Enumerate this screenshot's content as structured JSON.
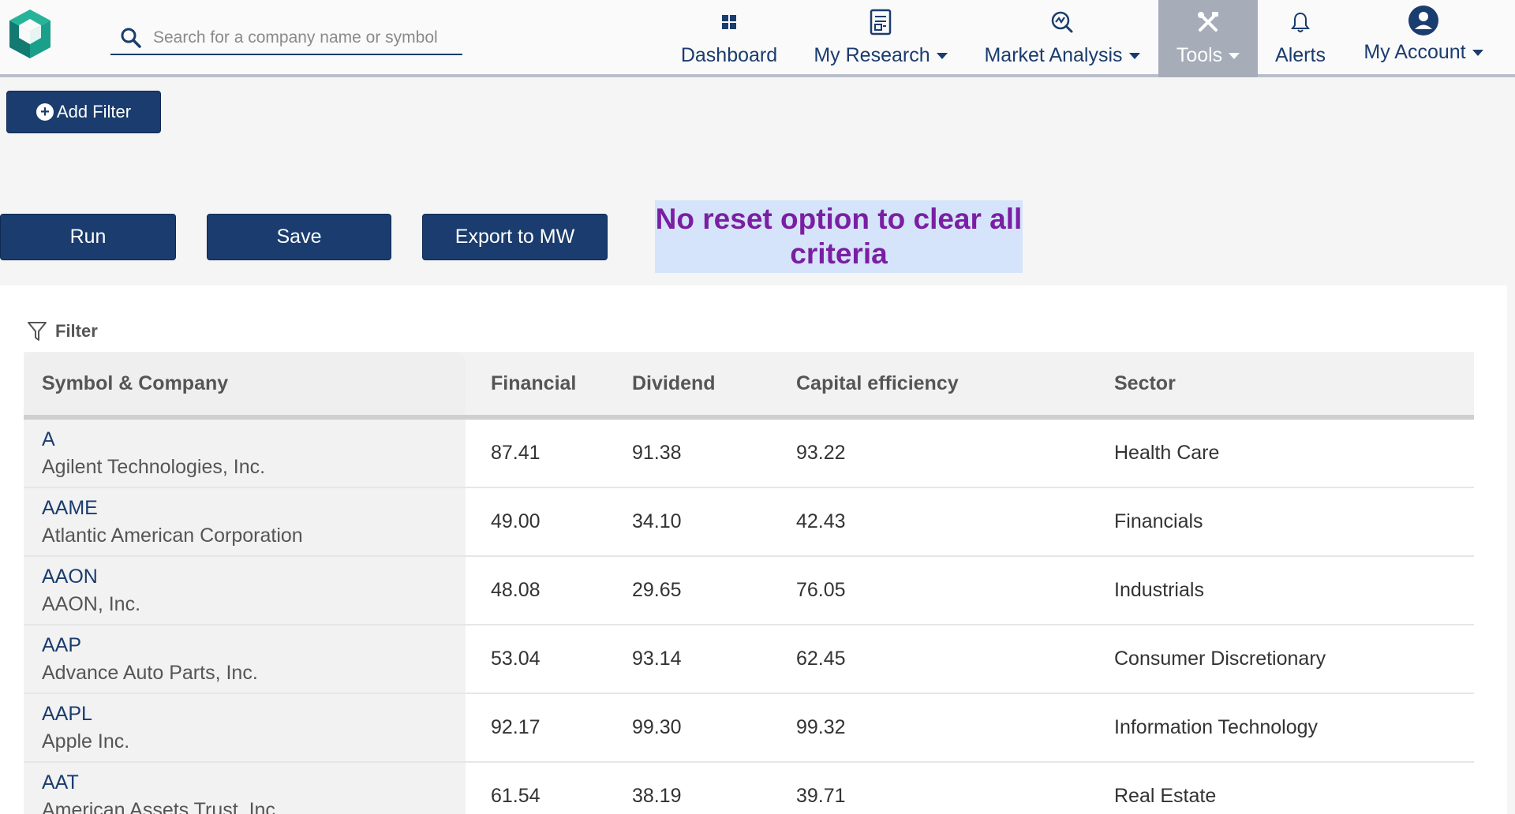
{
  "header": {
    "search_placeholder": "Search for a company name or symbol",
    "nav": [
      {
        "label": "Dashboard",
        "icon": "dashboard-icon",
        "dropdown": false
      },
      {
        "label": "My Research",
        "icon": "document-icon",
        "dropdown": true
      },
      {
        "label": "Market Analysis",
        "icon": "analysis-icon",
        "dropdown": true
      },
      {
        "label": "Tools",
        "icon": "tools-icon",
        "dropdown": true,
        "active": true
      },
      {
        "label": "Alerts",
        "icon": "bell-icon",
        "dropdown": false
      },
      {
        "label": "My Account",
        "icon": "user-icon",
        "dropdown": true
      }
    ]
  },
  "controls": {
    "add_filter": "Add Filter",
    "run": "Run",
    "save": "Save",
    "export": "Export to MW"
  },
  "annotation": {
    "line1": "No reset option to clear all",
    "line2": "criteria"
  },
  "table": {
    "filter_label": "Filter",
    "headers": [
      "Symbol & Company",
      "Financial",
      "Dividend",
      "Capital efficiency",
      "Sector"
    ],
    "rows": [
      {
        "ticker": "A",
        "company": "Agilent Technologies, Inc.",
        "financial": "87.41",
        "dividend": "91.38",
        "capital": "93.22",
        "sector": "Health Care"
      },
      {
        "ticker": "AAME",
        "company": "Atlantic American Corporation",
        "financial": "49.00",
        "dividend": "34.10",
        "capital": "42.43",
        "sector": "Financials"
      },
      {
        "ticker": "AAON",
        "company": "AAON, Inc.",
        "financial": "48.08",
        "dividend": "29.65",
        "capital": "76.05",
        "sector": "Industrials"
      },
      {
        "ticker": "AAP",
        "company": "Advance Auto Parts, Inc.",
        "financial": "53.04",
        "dividend": "93.14",
        "capital": "62.45",
        "sector": "Consumer Discretionary"
      },
      {
        "ticker": "AAPL",
        "company": "Apple Inc.",
        "financial": "92.17",
        "dividend": "99.30",
        "capital": "99.32",
        "sector": "Information Technology"
      },
      {
        "ticker": "AAT",
        "company": "American Assets Trust, Inc.",
        "financial": "61.54",
        "dividend": "38.19",
        "capital": "39.71",
        "sector": "Real Estate"
      }
    ]
  },
  "colors": {
    "brand_navy": "#1a3c6e",
    "logo_teal": "#1aa08a",
    "annotation_bg": "#d6e4fb",
    "annotation_text": "#7a1fa2",
    "active_tab": "#a6adb9"
  }
}
